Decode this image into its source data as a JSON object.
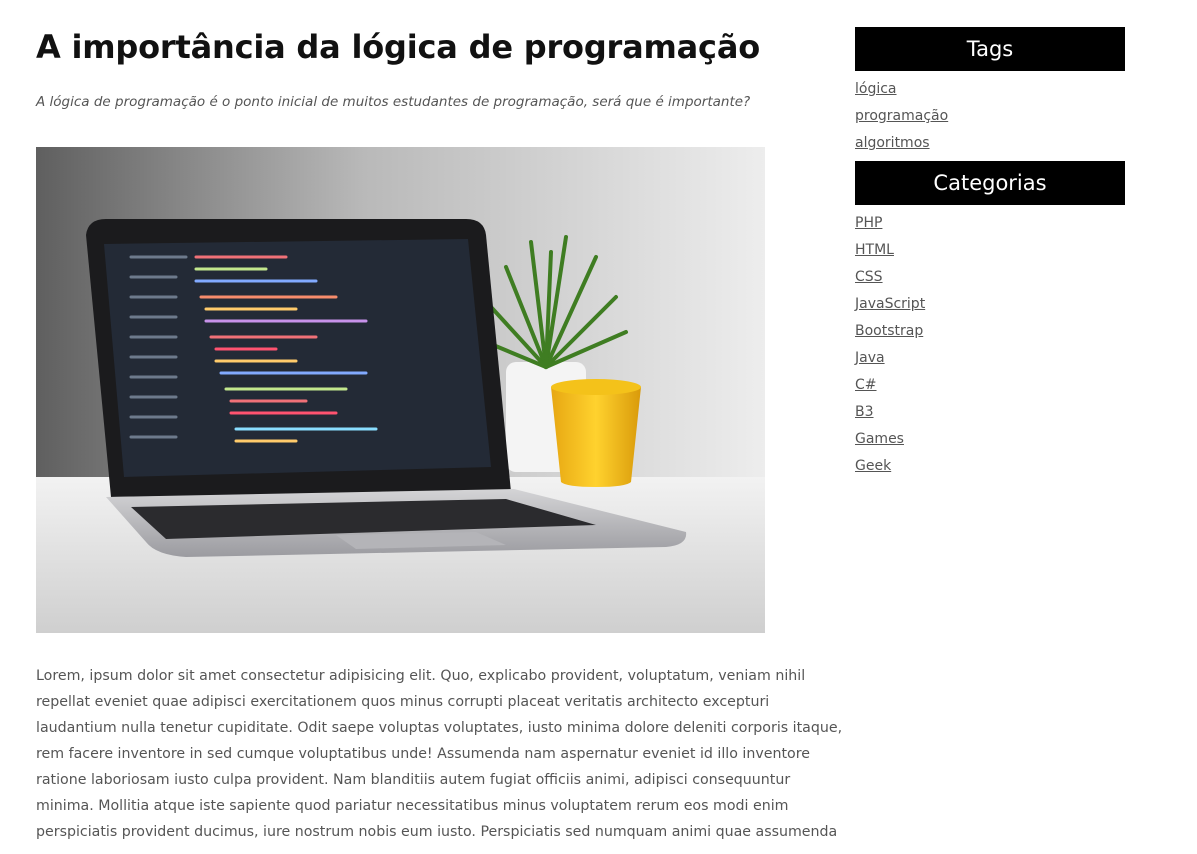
{
  "article": {
    "title": "A importância da lógica de programação",
    "subtitle": "A lógica de programação é o ponto inicial de muitos estudantes de programação, será que é importante?",
    "body": "Lorem, ipsum dolor sit amet consectetur adipisicing elit. Quo, explicabo provident, voluptatum, veniam nihil repellat eveniet quae adipisci exercitationem quos minus corrupti placeat veritatis architecto excepturi laudantium nulla tenetur cupiditate. Odit saepe voluptas voluptates, iusto minima dolore deleniti corporis itaque, rem facere inventore in sed cumque voluptatibus unde! Assumenda nam aspernatur eveniet id illo inventore ratione laboriosam iusto culpa provident. Nam blanditiis autem fugiat officiis animi, adipisci consequuntur minima. Mollitia atque iste sapiente quod pariatur necessitatibus minus voluptatem rerum eos modi enim perspiciatis provident ducimus, iure nostrum nobis eum iusto. Perspiciatis sed numquam animi quae assumenda"
  },
  "sidebar": {
    "tags": {
      "heading": "Tags",
      "items": [
        {
          "label": "lógica"
        },
        {
          "label": "programação"
        },
        {
          "label": "algoritmos"
        }
      ]
    },
    "categories": {
      "heading": "Categorias",
      "items": [
        {
          "label": "PHP"
        },
        {
          "label": "HTML"
        },
        {
          "label": "CSS"
        },
        {
          "label": "JavaScript"
        },
        {
          "label": "Bootstrap"
        },
        {
          "label": "Java"
        },
        {
          "label": "C#"
        },
        {
          "label": "B3"
        },
        {
          "label": "Games"
        },
        {
          "label": "Geek"
        }
      ]
    }
  },
  "colors": {
    "sidebar_heading_bg": "#000000",
    "sidebar_heading_text": "#ffffff",
    "link": "#555555",
    "title": "#111111"
  }
}
